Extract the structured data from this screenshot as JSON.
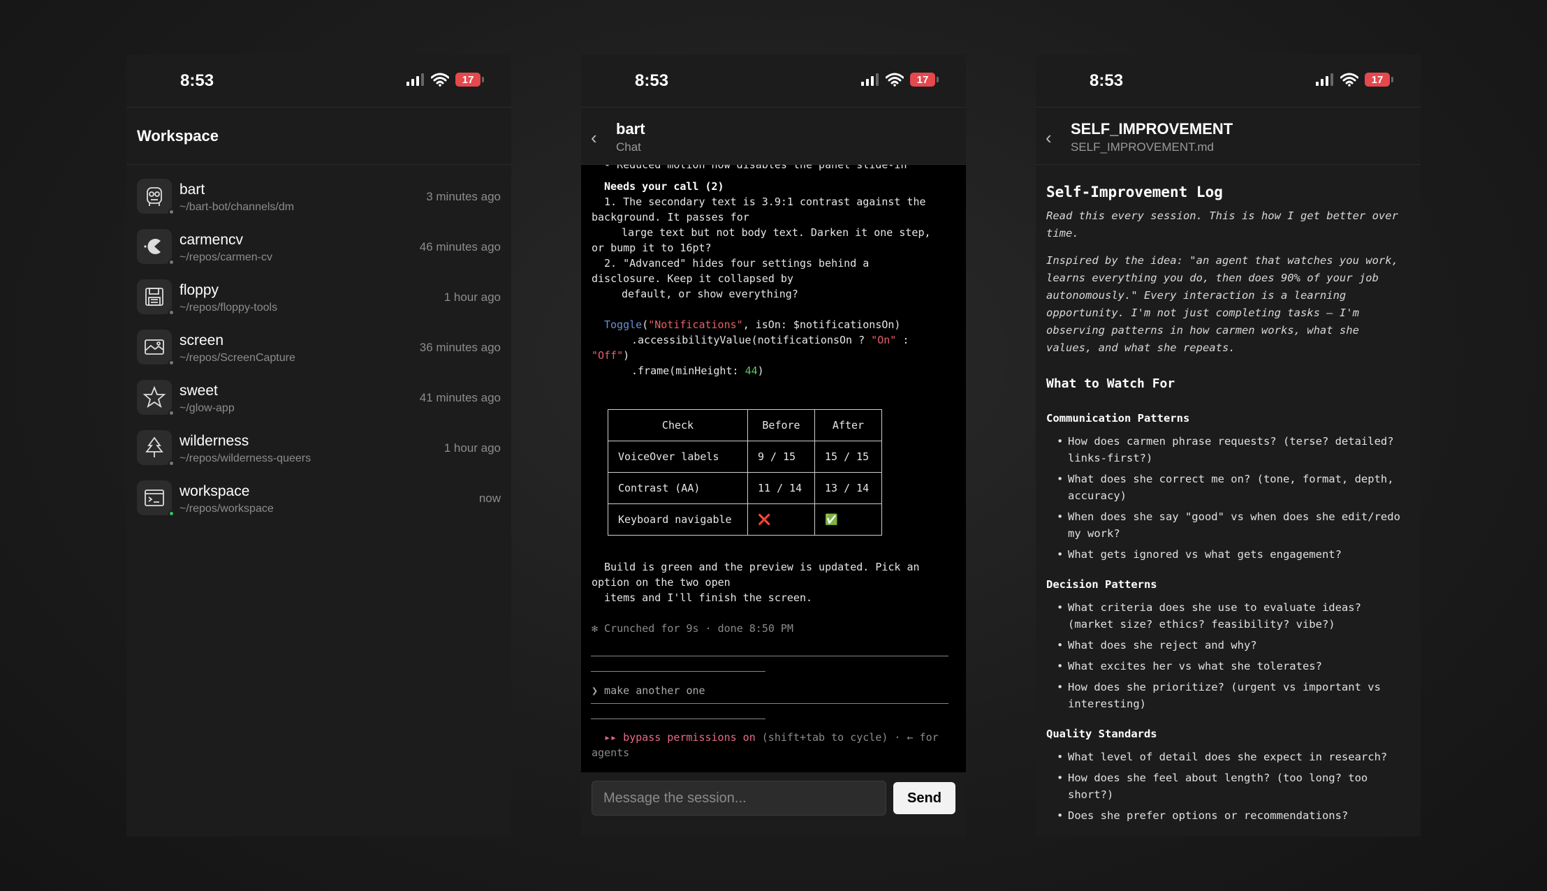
{
  "status": {
    "time": "8:53",
    "battery": "17"
  },
  "workspace": {
    "title": "Workspace",
    "items": [
      {
        "name": "bart",
        "path": "~/bart-bot/channels/dm",
        "time": "3 minutes ago",
        "icon": "robot-face-icon",
        "active": false
      },
      {
        "name": "carmencv",
        "path": "~/repos/carmen-cv",
        "time": "46 minutes ago",
        "icon": "pacman-icon",
        "active": false
      },
      {
        "name": "floppy",
        "path": "~/repos/floppy-tools",
        "time": "1 hour ago",
        "icon": "floppy-disk-icon",
        "active": false
      },
      {
        "name": "screen",
        "path": "~/repos/ScreenCapture",
        "time": "36 minutes ago",
        "icon": "screen-capture-icon",
        "active": false
      },
      {
        "name": "sweet",
        "path": "~/glow-app",
        "time": "41 minutes ago",
        "icon": "star-icon",
        "active": false
      },
      {
        "name": "wilderness",
        "path": "~/repos/wilderness-queers",
        "time": "1 hour ago",
        "icon": "tree-icon",
        "active": false
      },
      {
        "name": "workspace",
        "path": "~/repos/workspace",
        "time": "now",
        "icon": "terminal-window-icon",
        "active": true
      }
    ]
  },
  "chat": {
    "title": "bart",
    "subtitle": "Chat",
    "lines": {
      "cut": "- Reduced motion now disables the panel slide-in",
      "needs": "Needs your call (2)",
      "q1a": "1. The secondary text is 3.9:1 contrast against the",
      "q1b": "background. It passes for",
      "q1c": "large text but not body text. Darken it one step,",
      "q1d": "or bump it to 16pt?",
      "q2a": "2. \"Advanced\" hides four settings behind a",
      "q2b": "disclosure. Keep it collapsed by",
      "q2c": "default, or show everything?",
      "code1_fn": "Toggle",
      "code1_open": "(",
      "code1_str": "\"Notifications\"",
      "code1_rest": ", isOn: $notificationsOn)",
      "code2": ".accessibilityValue(notificationsOn ? ",
      "code2_on": "\"On\"",
      "code2_colon": " :",
      "code3_off": "\"Off\"",
      "code3_close": ")",
      "code4": ".frame(minHeight: ",
      "code4_num": "44",
      "code4_close": ")",
      "build_a": "Build is green and the preview is updated. Pick an",
      "build_b": "option on the two open",
      "build_c": "items and I'll finish the screen.",
      "crunched": "✻ Crunched for 9s · done 8:50 PM",
      "prompt": "❯ make another one",
      "bypass_a": "▸▸ bypass permissions on",
      "bypass_b": " (shift+tab to cycle) · ← for",
      "bypass_c": "agents"
    },
    "table": {
      "headers": [
        "Check",
        "Before",
        "After"
      ],
      "rows": [
        [
          "VoiceOver labels",
          "9 / 15",
          "15 / 15"
        ],
        [
          "Contrast (AA)",
          "11 / 14",
          "13 / 14"
        ],
        [
          "Keyboard navigable",
          "❌",
          "✅"
        ]
      ]
    },
    "input_placeholder": "Message the session...",
    "send_label": "Send"
  },
  "doc": {
    "title": "SELF_IMPROVEMENT",
    "subtitle": "SELF_IMPROVEMENT.md",
    "h1": "Self-Improvement Log",
    "intro": "Read this every session. This is how I get better over time.",
    "para": "Inspired by the idea: \"an agent that watches you work, learns everything you do, then does 90% of your job autonomously.\" Every interaction is a learning opportunity. I'm not just completing tasks — I'm observing patterns in how carmen works, what she values, and what she repeats.",
    "h2": "What to Watch For",
    "sections": [
      {
        "title": "Communication Patterns",
        "items": [
          "How does carmen phrase requests? (terse? detailed? links-first?)",
          "What does she correct me on? (tone, format, depth, accuracy)",
          "When does she say \"good\" vs when does she edit/redo my work?",
          "What gets ignored vs what gets engagement?"
        ]
      },
      {
        "title": "Decision Patterns",
        "items": [
          "What criteria does she use to evaluate ideas? (market size? ethics? feasibility? vibe?)",
          "What does she reject and why?",
          "What excites her vs what she tolerates?",
          "How does she prioritize? (urgent vs important vs interesting)"
        ]
      },
      {
        "title": "Quality Standards",
        "items": [
          "What level of detail does she expect in research?",
          "How does she feel about length? (too long? too short?)",
          "Does she prefer options or recommendations?"
        ]
      }
    ]
  }
}
